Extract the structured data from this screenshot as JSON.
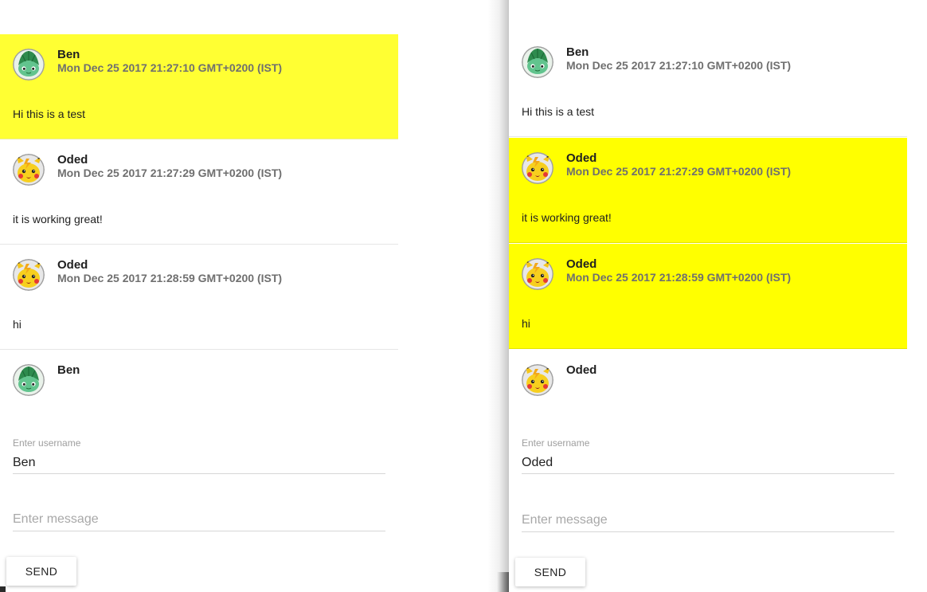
{
  "left": {
    "messages": [
      {
        "name": "Ben",
        "time": "Mon Dec 25 2017 21:27:10 GMT+0200 (IST)",
        "text": "Hi this is a test",
        "avatar": "bulbasaur-avatar",
        "highlighted": true
      },
      {
        "name": "Oded",
        "time": "Mon Dec 25 2017 21:27:29 GMT+0200 (IST)",
        "text": "it is working great!",
        "avatar": "pikachu-avatar",
        "highlighted": false
      },
      {
        "name": "Oded",
        "time": "Mon Dec 25 2017 21:28:59 GMT+0200 (IST)",
        "text": "hi",
        "avatar": "pikachu-avatar",
        "highlighted": false
      }
    ],
    "current_user": {
      "name": "Ben",
      "avatar": "bulbasaur-avatar"
    },
    "username_label": "Enter username",
    "username_value": "Ben",
    "message_placeholder": "Enter message",
    "send_label": "SEND"
  },
  "right": {
    "messages": [
      {
        "name": "Ben",
        "time": "Mon Dec 25 2017 21:27:10 GMT+0200 (IST)",
        "text": "Hi this is a test",
        "avatar": "bulbasaur-avatar",
        "highlighted": false
      },
      {
        "name": "Oded",
        "time": "Mon Dec 25 2017 21:27:29 GMT+0200 (IST)",
        "text": "it is working great!",
        "avatar": "pikachu-avatar",
        "highlighted": true
      },
      {
        "name": "Oded",
        "time": "Mon Dec 25 2017 21:28:59 GMT+0200 (IST)",
        "text": "hi",
        "avatar": "pikachu-avatar",
        "highlighted": true
      }
    ],
    "current_user": {
      "name": "Oded",
      "avatar": "pikachu-avatar"
    },
    "username_label": "Enter username",
    "username_value": "Oded",
    "message_placeholder": "Enter message",
    "send_label": "SEND"
  },
  "colors": {
    "highlight_left": "#ffff33",
    "highlight_right": "#ffff00",
    "timestamp": "#6f6f6f",
    "placeholder": "#a8a8a8"
  }
}
